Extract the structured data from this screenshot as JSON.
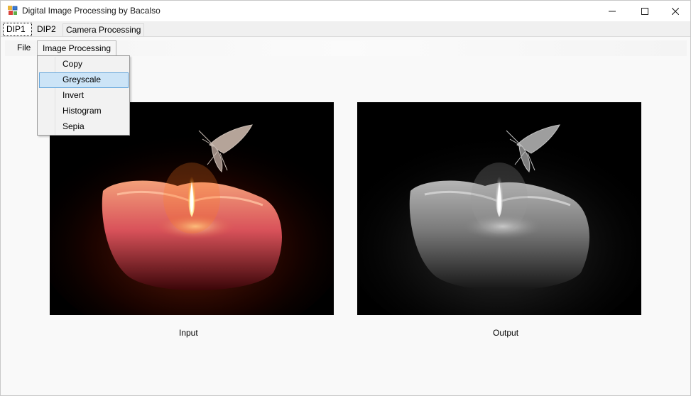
{
  "window": {
    "title": "Digital Image Processing by Bacalso",
    "icon": "app-icon",
    "controls": [
      "minimize-icon",
      "maximize-icon",
      "close-icon"
    ]
  },
  "tabs": [
    {
      "label": "DIP1",
      "selected": true
    },
    {
      "label": "DIP2",
      "selected": false
    },
    {
      "label": "Camera Processing",
      "selected": false
    }
  ],
  "menubar": {
    "file_label": "File",
    "image_processing_label": "Image Processing"
  },
  "dropdown": {
    "items": [
      {
        "label": "Copy",
        "highlighted": false
      },
      {
        "label": "Greyscale",
        "highlighted": true
      },
      {
        "label": "Invert",
        "highlighted": false
      },
      {
        "label": "Histogram",
        "highlighted": false
      },
      {
        "label": "Sepia",
        "highlighted": false
      }
    ]
  },
  "panels": {
    "input_label": "Input",
    "output_label": "Output",
    "input_image": "candle-with-moth-color",
    "output_image": "candle-with-moth-greyscale"
  },
  "colors": {
    "highlight_bg": "#cce4f7",
    "highlight_border": "#6aa9dd",
    "window_bg": "#f9f9f9"
  }
}
